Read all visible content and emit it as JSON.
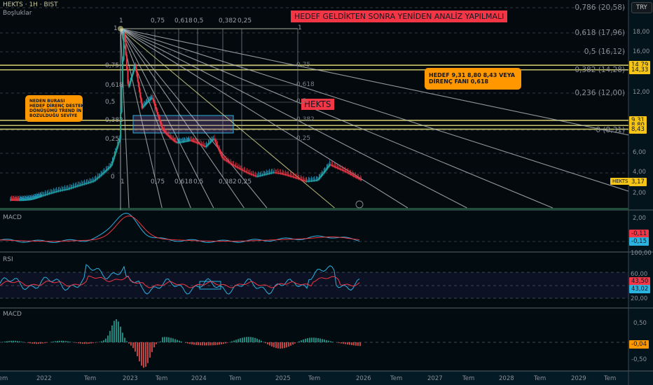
{
  "header": {
    "symbol": "HEKTS · 1H · BIST",
    "indicator": "Boşluklar",
    "currency": "TRY"
  },
  "annotations": {
    "title_note": "HEDEF GELDİKTEN SONRA YENİDEN ANALİZ YAPILMALI",
    "symbol_tag": "HEKTS",
    "left_callout": [
      "NEDEN BURASI",
      "HEDEF DİRENÇ DESTEK",
      "DÖNÜŞÜMÜ TREND İN",
      "BOZULDUĞU SEVİYE"
    ],
    "right_callout": [
      "HEDEF  9,31 8,80 8,43 VEYA",
      "DİRENÇ FANI 0,618"
    ]
  },
  "fan": {
    "top_labels": [
      "1",
      "0,75",
      "0,618",
      "0,5",
      "0,382",
      "0,25"
    ],
    "right_top": "1",
    "left_labels": [
      "1",
      "0,75",
      "0,618",
      "0,5",
      "0,382",
      "0,25",
      "0"
    ],
    "right_labels": [
      "0,75",
      "0,618",
      "0,5",
      "0,382",
      "0,25"
    ],
    "bottom_labels": [
      "1",
      "0,75",
      "0,618",
      "0,5",
      "0,382",
      "0,25"
    ]
  },
  "fib_levels": [
    {
      "label": "0,786 (20,58)"
    },
    {
      "label": "0,618 (17,96)"
    },
    {
      "label": "0,5 (16,12)"
    },
    {
      "label": "0,382 (14,28)"
    },
    {
      "label": "0,236 (12,00)"
    },
    {
      "label": "0 (8,31)"
    }
  ],
  "price_axis": {
    "ticks": [
      "18,00",
      "16,00",
      "12,00",
      "6,00",
      "4,00",
      "2,00"
    ],
    "tags": [
      {
        "text": "14,79",
        "price": 14.79
      },
      {
        "text": "14,33",
        "price": 14.33
      },
      {
        "text": "9,31",
        "price": 9.31
      },
      {
        "text": "8,80",
        "price": 8.8
      },
      {
        "text": "8,43",
        "price": 8.43
      }
    ],
    "last_name": "HEKTS",
    "last_price": "3,17"
  },
  "price_path": [
    [
      2021.4,
      1.4
    ],
    [
      2021.8,
      1.6
    ],
    [
      2022.0,
      1.8
    ],
    [
      2022.3,
      2.4
    ],
    [
      2022.6,
      3.5
    ],
    [
      2022.8,
      5
    ],
    [
      2022.9,
      7.5
    ],
    [
      2022.95,
      18
    ],
    [
      2023.0,
      12
    ],
    [
      2023.1,
      14
    ],
    [
      2023.2,
      10
    ],
    [
      2023.35,
      11.5
    ],
    [
      2023.5,
      8.8
    ],
    [
      2023.7,
      7.5
    ],
    [
      2023.9,
      7.2
    ],
    [
      2024.1,
      6.3
    ],
    [
      2024.2,
      7.2
    ],
    [
      2024.3,
      5.5
    ],
    [
      2024.5,
      4.8
    ],
    [
      2024.7,
      3.9
    ],
    [
      2024.9,
      4.0
    ],
    [
      2025.1,
      3.6
    ],
    [
      2025.3,
      3.3
    ],
    [
      2025.45,
      3.6
    ],
    [
      2025.6,
      5.2
    ],
    [
      2025.75,
      4.4
    ],
    [
      2025.9,
      3.6
    ],
    [
      2026.0,
      3.17
    ]
  ],
  "macd_pane": {
    "title": "MACD",
    "tick": "2,00",
    "macd": "-0,11",
    "signal": "-0,15"
  },
  "rsi_pane": {
    "title": "RSI",
    "ticks": [
      "100,00",
      "60,00",
      "20,00"
    ],
    "rsi": "43,50",
    "ma": "43,02"
  },
  "hist_pane": {
    "title": "MACD",
    "ticks": [
      "0,50",
      "-0,50"
    ],
    "value": "-0,04"
  },
  "time_axis": [
    "Tem",
    "2022",
    "Tem",
    "2023",
    "Tem",
    "2024",
    "Tem",
    "2025",
    "Tem",
    "2026",
    "Tem",
    "2027",
    "Tem",
    "2028",
    "Tem",
    "2029",
    "Tem"
  ],
  "colors": {
    "up": "#22ab94",
    "down": "#f23645",
    "fib": "#c9c46b",
    "fan": "#9aa0a6",
    "callout": "#ff9800",
    "note": "#f23645",
    "blue": "#2ab2e0"
  }
}
